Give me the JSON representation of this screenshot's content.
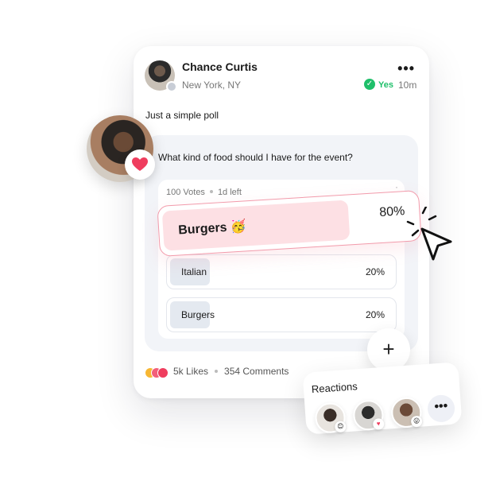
{
  "post": {
    "user_name": "Chance Curtis",
    "location": "New York, NY",
    "status_label": "Yes",
    "time_ago": "10m",
    "menu_label": "•••",
    "text": "Just a simple poll"
  },
  "poll": {
    "question": "What kind of food should I have for the event?",
    "votes": "100 Votes",
    "time_left": "1d left",
    "options": [
      {
        "label": "Italian",
        "percent_label": "20%",
        "percent": 20
      },
      {
        "label": "Burgers",
        "percent_label": "20%",
        "percent": 20
      }
    ],
    "highlighted": {
      "label": "Burgers 🥳",
      "percent_label": "80%",
      "percent": 80
    }
  },
  "footer": {
    "likes": "5k Likes",
    "comments": "354 Comments"
  },
  "add_button": "+",
  "reactions": {
    "title": "Reactions",
    "more_label": "•••"
  },
  "colors": {
    "accent_pink": "#f29bab",
    "fill_pink": "#fde0e4",
    "verified_green": "#1fbf6a",
    "heart_red": "#ef3d5e"
  }
}
